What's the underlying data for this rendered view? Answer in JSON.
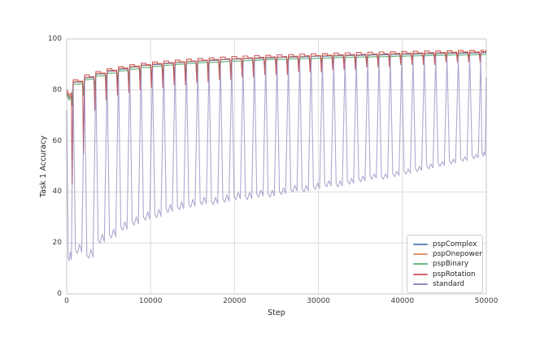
{
  "chart_data": {
    "type": "line",
    "title": "",
    "xlabel": "Step",
    "ylabel": "Task 1 Accuracy",
    "xlim": [
      0,
      50000
    ],
    "ylim": [
      0,
      100
    ],
    "xticks": [
      0,
      10000,
      20000,
      30000,
      40000,
      50000
    ],
    "yticks": [
      0,
      20,
      40,
      60,
      80,
      100
    ],
    "grid": true,
    "grid_color": "#dcdcdc",
    "spine_color": "#c8c8c8",
    "legend_position": "lower right",
    "series": [
      {
        "name": "pspComplex",
        "color": "#4C72B0",
        "column": "pspComplex"
      },
      {
        "name": "pspOnepower",
        "color": "#DD8452",
        "column": "pspOnepower"
      },
      {
        "name": "pspBinary",
        "color": "#55A868",
        "column": "pspBinary"
      },
      {
        "name": "pspRotation",
        "color": "#C44E52",
        "column": "pspRotation"
      },
      {
        "name": "standard",
        "color": "#8172B3",
        "column": "standard"
      }
    ],
    "end_step": 50000,
    "standard_end_value": 85,
    "cycles": {
      "description": "Per task-switch cycle: plateau accuracy of each psp series, dip depths at cycle end, and standard-series peak/trough.",
      "columns": [
        "step_start",
        "pspRotation",
        "pspOnepower",
        "pspComplex",
        "pspBinary",
        "pspRotation_dip",
        "psp_dip",
        "standard_peak",
        "standard_trough"
      ],
      "rows": [
        [
          0,
          78.9,
          78.2,
          77.8,
          77.0,
          43,
          74,
          72,
          13
        ],
        [
          700,
          84.0,
          83.3,
          83.0,
          82.2,
          55,
          78,
          81.5,
          16
        ],
        [
          2050,
          85.9,
          85.0,
          84.7,
          84.0,
          72,
          80,
          83.5,
          14
        ],
        [
          3400,
          87.2,
          86.5,
          86.2,
          85.4,
          76,
          82,
          85.0,
          20
        ],
        [
          4750,
          88.3,
          87.6,
          87.3,
          86.5,
          78,
          83,
          86.2,
          22
        ],
        [
          6100,
          89.2,
          88.5,
          88.1,
          87.4,
          79,
          84,
          87.0,
          25
        ],
        [
          7450,
          89.9,
          89.2,
          88.9,
          88.1,
          80,
          85,
          87.8,
          27
        ],
        [
          8800,
          90.5,
          89.8,
          89.5,
          88.7,
          81,
          85,
          88.4,
          29
        ],
        [
          10150,
          91.0,
          90.2,
          89.9,
          89.2,
          81,
          86,
          88.9,
          30
        ],
        [
          11500,
          91.4,
          90.6,
          90.3,
          89.6,
          82,
          86,
          89.3,
          32
        ],
        [
          12850,
          91.7,
          90.9,
          90.7,
          90.0,
          82,
          87,
          89.7,
          33
        ],
        [
          14200,
          92.1,
          91.2,
          91.0,
          90.3,
          83,
          87,
          90.0,
          34
        ],
        [
          15550,
          92.4,
          91.5,
          91.3,
          90.6,
          83,
          88,
          90.3,
          35
        ],
        [
          16900,
          92.6,
          91.8,
          91.5,
          90.8,
          84,
          88,
          90.5,
          35
        ],
        [
          18250,
          92.9,
          92.0,
          91.8,
          91.0,
          84,
          88,
          90.8,
          36
        ],
        [
          19600,
          93.1,
          92.2,
          92.0,
          91.2,
          85,
          89,
          91.0,
          37
        ],
        [
          20950,
          93.3,
          92.4,
          92.2,
          91.4,
          85,
          89,
          91.2,
          37
        ],
        [
          22300,
          93.5,
          92.6,
          92.3,
          91.6,
          86,
          89,
          91.4,
          38
        ],
        [
          23650,
          93.6,
          92.8,
          92.5,
          91.8,
          86,
          90,
          91.5,
          38
        ],
        [
          25000,
          93.8,
          92.9,
          92.7,
          91.9,
          86,
          90,
          91.7,
          39
        ],
        [
          26350,
          93.9,
          93.1,
          92.8,
          92.1,
          87,
          90,
          91.8,
          40
        ],
        [
          27700,
          94.1,
          93.2,
          92.9,
          92.2,
          87,
          90,
          92.0,
          40
        ],
        [
          29050,
          94.2,
          93.3,
          93.1,
          92.3,
          87,
          91,
          92.1,
          41
        ],
        [
          30400,
          94.3,
          93.5,
          93.2,
          92.4,
          88,
          91,
          92.2,
          42
        ],
        [
          31750,
          94.5,
          93.6,
          93.3,
          92.6,
          88,
          91,
          92.3,
          42
        ],
        [
          33100,
          94.6,
          93.7,
          93.4,
          92.7,
          88,
          91,
          92.4,
          43
        ],
        [
          34450,
          94.7,
          93.8,
          93.5,
          92.8,
          89,
          91,
          92.5,
          44
        ],
        [
          35800,
          94.8,
          93.9,
          93.6,
          92.9,
          89,
          92,
          92.6,
          45
        ],
        [
          37150,
          94.9,
          94.0,
          93.7,
          93.0,
          89,
          92,
          92.7,
          45
        ],
        [
          38500,
          95.0,
          94.2,
          93.8,
          93.1,
          90,
          92,
          92.8,
          46
        ],
        [
          39850,
          95.1,
          94.3,
          93.9,
          93.2,
          90,
          92,
          92.9,
          47
        ],
        [
          41200,
          95.2,
          94.4,
          94.0,
          93.3,
          90,
          92,
          93.0,
          48
        ],
        [
          42550,
          95.3,
          94.5,
          94.1,
          93.4,
          90,
          93,
          93.1,
          49
        ],
        [
          43900,
          95.3,
          94.6,
          94.2,
          93.5,
          91,
          93,
          93.2,
          50
        ],
        [
          45250,
          95.4,
          94.7,
          94.3,
          93.6,
          91,
          93,
          93.2,
          51
        ],
        [
          46600,
          95.5,
          94.8,
          94.3,
          93.6,
          91,
          93,
          93.3,
          52
        ],
        [
          47950,
          95.5,
          94.8,
          94.4,
          93.7,
          91,
          93,
          93.4,
          53
        ],
        [
          49300,
          95.6,
          94.9,
          94.5,
          93.8,
          92,
          93,
          93.4,
          54
        ]
      ]
    }
  }
}
